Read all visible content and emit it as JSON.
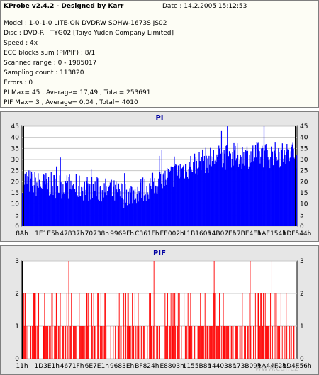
{
  "header": {
    "title": "KProbe v2.4.2 - Designed by Karr",
    "date": "Date : 14.2.2005 15:12:53"
  },
  "info": {
    "model": "Model : 1-0-1-0 LITE-ON DVDRW SOHW-1673S JS02",
    "disc": "Disc : DVD-R , TYG02 [Taiyo Yuden Company Limited]",
    "speed": "Speed : 4x",
    "ecc": "ECC blocks sum (PI/PIF) : 8/1",
    "scanned": "Scanned range : 0 - 1985017",
    "sampling": "Sampling count : 113820",
    "errors": "Errors : 0",
    "pi_stats": "PI Max= 45 , Average= 17,49 , Total= 253691",
    "pif_stats": "PIF Max= 3 , Average= 0,04 , Total= 4010"
  },
  "watermark": "www.cdr.cz",
  "chart_data": [
    {
      "type": "bar",
      "title": "PI",
      "color": "#0000ff",
      "ylim": [
        0,
        45
      ],
      "yticks": [
        0,
        5,
        10,
        15,
        20,
        25,
        30,
        35,
        40,
        45
      ],
      "xtick_labels": [
        "8Ah",
        "1E1E5h",
        "47837h",
        "70738h",
        "9969Fh",
        "C361Fh",
        "EE002h",
        "11B160h",
        "14B07Eh",
        "17BE4Eh",
        "1AE154h",
        "1DF544h"
      ],
      "profile_x": [
        0,
        0.05,
        0.15,
        0.25,
        0.3,
        0.38,
        0.45,
        0.5,
        0.55,
        0.62,
        0.72,
        0.85,
        1.0
      ],
      "profile_y": [
        21,
        19,
        18,
        17,
        16,
        14,
        17,
        20,
        23,
        28,
        31,
        32,
        32
      ],
      "max": 45
    },
    {
      "type": "bar",
      "title": "PIF",
      "color": "#ff0000",
      "ylim": [
        0,
        3
      ],
      "yticks": [
        0,
        1,
        2,
        3
      ],
      "xtick_labels": [
        "11h",
        "1D3E1h",
        "4671Fh",
        "6E7E1h",
        "9683Eh",
        "BF824h",
        "E8803h",
        "1155B8h",
        "144038h",
        "173B09h",
        "1A44E2h",
        "1D4E56h"
      ],
      "spikes_x": [
        0.17,
        0.48,
        0.7,
        0.83,
        0.91
      ],
      "max": 3
    }
  ]
}
